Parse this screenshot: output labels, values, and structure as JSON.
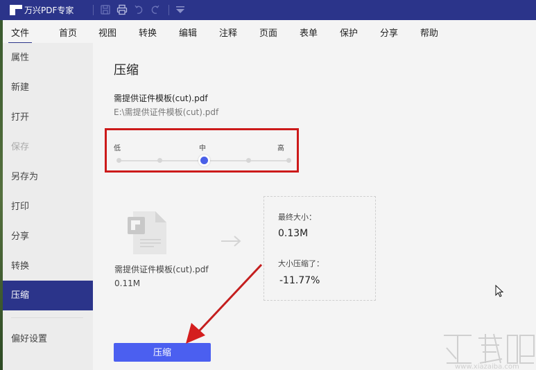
{
  "app": {
    "title": "万兴PDF专家",
    "toolbar_icons": [
      "save-icon",
      "print-icon",
      "undo-icon",
      "redo-icon",
      "dropdown-icon"
    ]
  },
  "menu": {
    "items": [
      {
        "label": "文件",
        "active": true
      },
      {
        "label": "首页"
      },
      {
        "label": "视图"
      },
      {
        "label": "转换"
      },
      {
        "label": "编辑"
      },
      {
        "label": "注释"
      },
      {
        "label": "页面"
      },
      {
        "label": "表单"
      },
      {
        "label": "保护"
      },
      {
        "label": "分享"
      },
      {
        "label": "帮助"
      }
    ]
  },
  "sidebar": {
    "items": [
      {
        "label": "属性"
      },
      {
        "label": "新建"
      },
      {
        "label": "打开"
      },
      {
        "label": "保存",
        "disabled": true
      },
      {
        "label": "另存为"
      },
      {
        "label": "打印"
      },
      {
        "label": "分享"
      },
      {
        "label": "转换"
      },
      {
        "label": "压缩",
        "active": true
      },
      {
        "label": "偏好设置"
      }
    ]
  },
  "compress": {
    "title": "压缩",
    "file_name": "需提供证件模板(cut).pdf",
    "file_path": "E:\\需提供证件模板(cut).pdf",
    "level": {
      "labels": [
        "低",
        "中",
        "高"
      ],
      "steps": 5,
      "selected_index": 2,
      "selected_label": "中"
    },
    "original": {
      "name": "需提供证件模板(cut).pdf",
      "size": "0.11M"
    },
    "result": {
      "final_size_label": "最终大小：",
      "final_size": "0.13M",
      "reduced_label": "大小压缩了：",
      "reduced": "-11.77%"
    },
    "button_label": "压缩"
  },
  "colors": {
    "brand": "#2b348a",
    "accent": "#4b5ff0",
    "annotation": "#cc1a1a"
  },
  "watermark": {
    "text": "下载吧",
    "url_text": "www.xiazaiba.com"
  }
}
